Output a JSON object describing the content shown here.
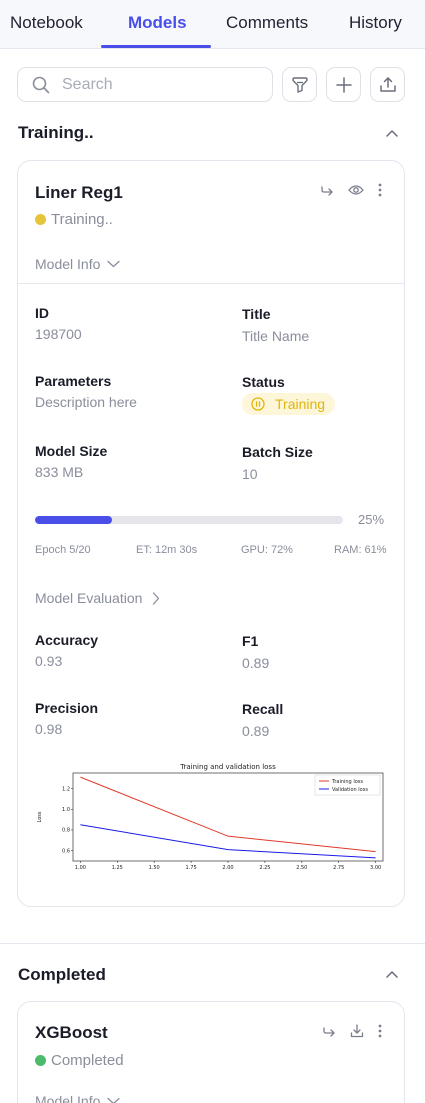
{
  "tabs": [
    {
      "label": "Notebook"
    },
    {
      "label": "Models"
    },
    {
      "label": "Comments"
    },
    {
      "label": "History"
    }
  ],
  "search": {
    "placeholder": "Search"
  },
  "colors": {
    "accent": "#4a4ee8",
    "training": "#e6c43a",
    "completed": "#4cbb6b"
  },
  "sections": {
    "training": {
      "title": "Training..",
      "card": {
        "name": "Liner Reg1",
        "status": "Training..",
        "model_info_label": "Model Info",
        "fields": {
          "id_label": "ID",
          "id_value": "198700",
          "title_label": "Title",
          "title_value": "Title Name",
          "params_label": "Parameters",
          "params_value": "Description here",
          "status_label": "Status",
          "status_value": "Training",
          "size_label": "Model Size",
          "size_value": "833 MB",
          "batch_label": "Batch Size",
          "batch_value": "10"
        },
        "progress": {
          "percent": 25,
          "percent_label": "25%"
        },
        "stats": {
          "epoch": "Epoch 5/20",
          "et": "ET: 12m 30s",
          "gpu": "GPU: 72%",
          "ram": "RAM: 61%"
        },
        "evaluation": {
          "label": "Model Evaluation",
          "accuracy_label": "Accuracy",
          "accuracy_value": "0.93",
          "f1_label": "F1",
          "f1_value": "0.89",
          "precision_label": "Precision",
          "precision_value": "0.98",
          "recall_label": "Recall",
          "recall_value": "0.89"
        }
      }
    },
    "completed": {
      "title": "Completed",
      "card": {
        "name": "XGBoost",
        "status": "Completed",
        "model_info_label": "Model Info"
      }
    }
  },
  "chart_data": {
    "type": "line",
    "title": "Training and validation loss",
    "xlabel": "",
    "ylabel": "Loss",
    "x": [
      1.0,
      2.0,
      3.0
    ],
    "series": [
      {
        "name": "Training loss",
        "color": "#e0392b",
        "values": [
          1.31,
          0.74,
          0.59
        ]
      },
      {
        "name": "Validation loss",
        "color": "#1a1ae6",
        "values": [
          0.85,
          0.61,
          0.53
        ]
      }
    ],
    "xlim": [
      0.95,
      3.05
    ],
    "ylim": [
      0.5,
      1.35
    ],
    "xticks": [
      "1.00",
      "1.25",
      "1.50",
      "1.75",
      "2.00",
      "2.25",
      "2.50",
      "2.75",
      "3.00"
    ],
    "yticks": [
      "0.6",
      "0.8",
      "1.0",
      "1.2"
    ],
    "legend": "top-right"
  }
}
